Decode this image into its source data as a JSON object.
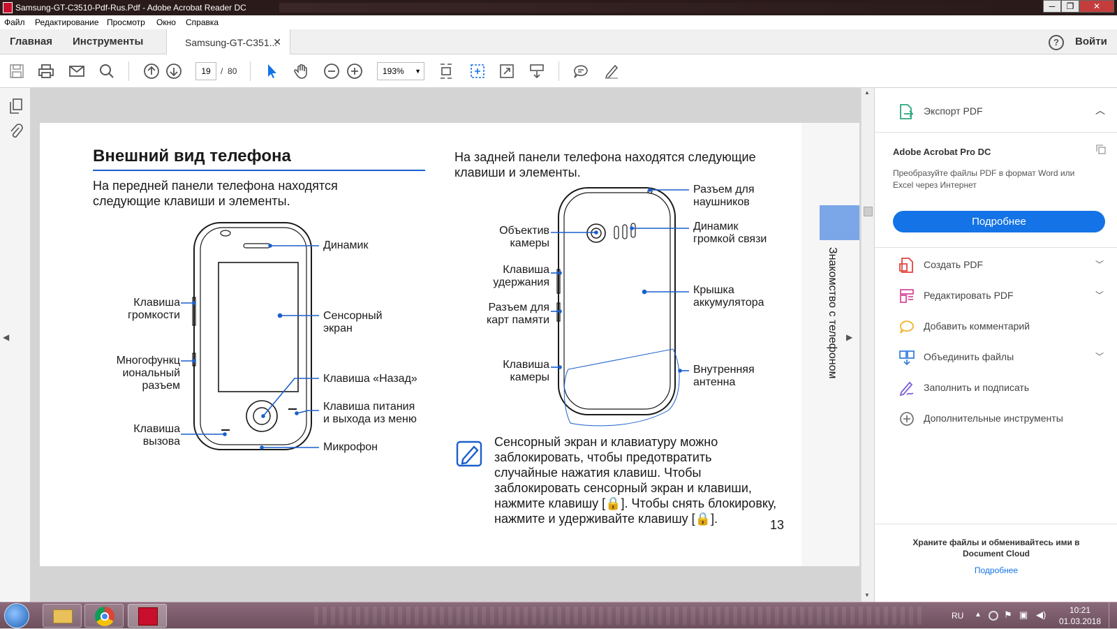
{
  "window": {
    "title": "Samsung-GT-C3510-Pdf-Rus.Pdf - Adobe Acrobat Reader DC",
    "minimize": "─",
    "maximize": "❐",
    "close": "✕"
  },
  "menu": [
    "Файл",
    "Редактирование",
    "Просмотр",
    "Окно",
    "Справка"
  ],
  "tabs": {
    "home": "Главная",
    "tools": "Инструменты",
    "document": "Samsung-GT-C351...",
    "close": "✕",
    "help": "?",
    "login": "Войти"
  },
  "toolbar": {
    "page_current": "19",
    "page_sep": "/",
    "page_total": "80",
    "zoom": "193%",
    "zoom_arrow": "▼"
  },
  "document": {
    "left": {
      "title": "Внешний вид телефона",
      "intro_line1": "На передней панели телефона находятся",
      "intro_line2": "следующие клавиши и элементы.",
      "labels": {
        "speaker": "Динамик",
        "volume_1": "Клавиша",
        "volume_2": "громкости",
        "touch_1": "Сенсорный",
        "touch_2": "экран",
        "multi_1": "Многофункц",
        "multi_2": "иональный",
        "multi_3": "разъем",
        "back": "Клавиша «Назад»",
        "power_1": "Клавиша питания",
        "power_2": "и выхода из меню",
        "call_1": "Клавиша",
        "call_2": "вызова",
        "mic": "Микрофон"
      }
    },
    "right": {
      "intro_line1": "На задней панели телефона находятся следующие",
      "intro_line2": "клавиши и элементы.",
      "labels": {
        "headphone_1": "Разъем для",
        "headphone_2": "наушников",
        "camera_lens_1": "Объектив",
        "camera_lens_2": "камеры",
        "loudspeaker_1": "Динамик",
        "loudspeaker_2": "громкой связи",
        "hold_1": "Клавиша",
        "hold_2": "удержания",
        "cover_1": "Крышка",
        "cover_2": "аккумулятора",
        "card_1": "Разъем для",
        "card_2": "карт памяти",
        "camera_key_1": "Клавиша",
        "camera_key_2": "камеры",
        "antenna_1": "Внутренняя",
        "antenna_2": "антенна"
      },
      "note": [
        "Сенсорный экран и клавиатуру можно",
        "заблокировать, чтобы предотвратить",
        "случайные нажатия клавиш. Чтобы",
        "заблокировать сенсорный экран и клавиши,",
        "нажмите клавишу [🔒]. Чтобы снять блокировку,",
        "нажмите и удерживайте клавишу [🔒]."
      ],
      "page_number": "13"
    },
    "side_tab": "Знакомство с телефоном"
  },
  "sidebar": {
    "export": "Экспорт PDF",
    "promo_title": "Adobe Acrobat Pro DC",
    "promo_text_1": "Преобразуйте файлы PDF в формат Word или",
    "promo_text_2": "Excel через Интернет",
    "promo_button": "Подробнее",
    "items": [
      {
        "label": "Создать PDF",
        "color": "#e0443e",
        "chevron": true
      },
      {
        "label": "Редактировать PDF",
        "color": "#d84b9a",
        "chevron": true
      },
      {
        "label": "Добавить комментарий",
        "color": "#f0b428",
        "chevron": false
      },
      {
        "label": "Объединить файлы",
        "color": "#3b7fe0",
        "chevron": true
      },
      {
        "label": "Заполнить и подписать",
        "color": "#7b5fd6",
        "chevron": false
      },
      {
        "label": "Дополнительные инструменты",
        "color": "#666666",
        "chevron": false
      }
    ],
    "cloud_text_1": "Храните файлы и обменивайтесь ими в",
    "cloud_text_2": "Document Cloud",
    "cloud_link": "Подробнее"
  },
  "taskbar": {
    "lang": "RU",
    "time": "10:21",
    "date": "01.03.2018"
  }
}
